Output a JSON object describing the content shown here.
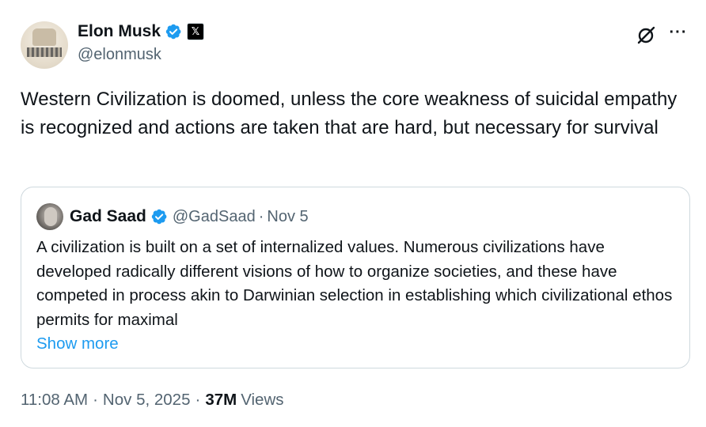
{
  "author": {
    "display_name": "Elon Musk",
    "handle": "@elonmusk",
    "affiliate_badge": "𝕏"
  },
  "icons": {
    "verified": "verified-badge-icon",
    "grok": "grok-icon",
    "more": "more-options-icon"
  },
  "more_glyph": "···",
  "tweet": {
    "text": "Western Civilization is doomed, unless the core weakness of suicidal empathy is recognized and actions are taken that are hard, but necessary for survival"
  },
  "quote": {
    "display_name": "Gad Saad",
    "handle": "@GadSaad",
    "separator": "·",
    "date": "Nov 5",
    "text": "A civilization is built on a set of internalized values.  Numerous civilizations have developed radically different visions of how to organize societies, and these have competed in process akin to Darwinian selection in establishing which civilizational ethos permits for maximal",
    "show_more": "Show more"
  },
  "meta": {
    "time": "11:08 AM",
    "separator": "·",
    "date": "Nov 5, 2025",
    "views_count": "37M",
    "views_label": "Views"
  },
  "colors": {
    "text": "#0f1419",
    "secondary": "#536471",
    "link": "#1d9bf0",
    "verified": "#1d9bf0",
    "border": "#cfd9de"
  }
}
